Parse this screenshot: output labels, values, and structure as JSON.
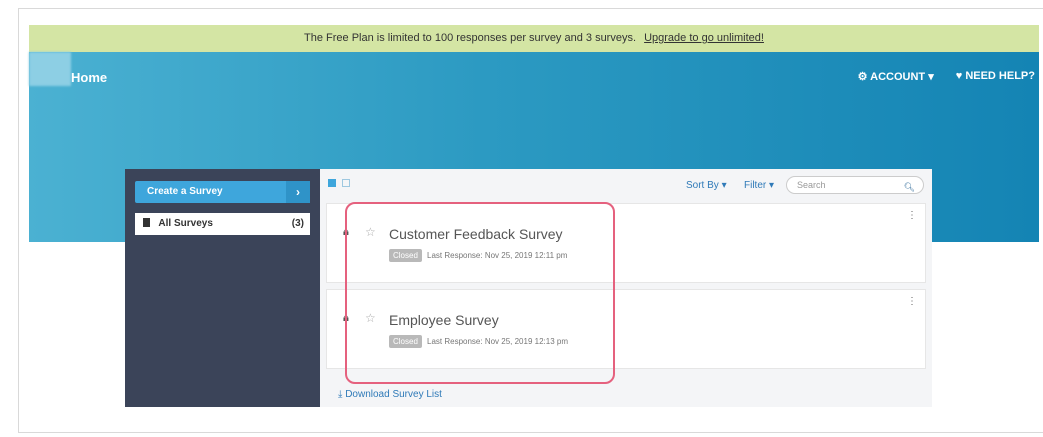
{
  "banner": {
    "text": "The Free Plan is limited to 100 responses per survey and 3 surveys.",
    "link": "Upgrade to go unlimited!"
  },
  "header": {
    "title": "Home",
    "account": "ACCOUNT",
    "help": "NEED HELP?"
  },
  "sidebar": {
    "create": "Create a Survey",
    "all_label": "All Surveys",
    "all_count": "(3)"
  },
  "toolbar": {
    "sort": "Sort By",
    "filter": "Filter",
    "search_placeholder": "Search"
  },
  "surveys": [
    {
      "title": "Customer Feedback Survey",
      "status": "Closed",
      "last": "Last Response: Nov 25, 2019 12:11 pm"
    },
    {
      "title": "Employee Survey",
      "status": "Closed",
      "last": "Last Response: Nov 25, 2019 12:13 pm"
    }
  ],
  "download": "Download Survey List",
  "colors": {
    "banner_bg": "#d4e5a4",
    "hero": "#2c9ac2",
    "sidebar_bg": "#3b4459",
    "accent": "#3ea6dc",
    "highlight": "#e5617e"
  },
  "icons": [
    "gear-icon",
    "heart-icon",
    "chevron-right-icon",
    "document-icon",
    "grid-icon",
    "list-icon",
    "search-icon",
    "lock-icon",
    "star-icon",
    "kebab-icon",
    "download-icon"
  ]
}
